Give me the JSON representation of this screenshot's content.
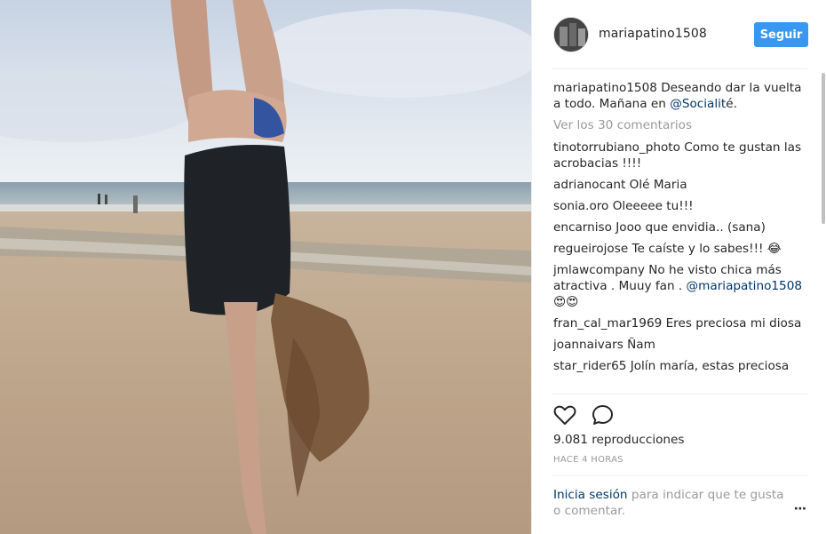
{
  "post": {
    "username": "mariapatino1508",
    "follow_label": "Seguir",
    "caption": {
      "username": "mariapatino1508",
      "text_before": " Deseando dar la vuelta a todo. Mañana en ",
      "mention": "@Socialit",
      "text_after": "é."
    },
    "view_more": "Ver los 30 comentarios",
    "comments": [
      {
        "user": "tinotorrubiano_photo",
        "text": " Como te gustan las acrobacias !!!!"
      },
      {
        "user": "adrianocant",
        "text": " Olé Maria"
      },
      {
        "user": "sonia.oro",
        "text": " Oleeeee tu!!!"
      },
      {
        "user": "encarniso",
        "text": " Jooo que envidia.. (sana)"
      },
      {
        "user": "regueirojose",
        "text": " Te caíste y lo sabes!!! 😂"
      },
      {
        "user": "jmlawcompany",
        "text": " No he visto chica más atractiva . Muuy fan . ",
        "mention": "@mariapatino1508",
        "after": " 😍😍"
      },
      {
        "user": "fran_cal_mar1969",
        "text": " Eres preciosa mi diosa"
      },
      {
        "user": "joannaivars",
        "text": " Ñam"
      },
      {
        "user": "star_rider65",
        "text": " Jolín maría, estas preciosa"
      }
    ],
    "views": "9.081 reproducciones",
    "time": "HACE 4 HORAS",
    "login": {
      "link": "Inicia sesión",
      "text": " para indicar que te gusta o comentar."
    },
    "more_icon": "⋯"
  },
  "icons": {
    "like": "heart-icon",
    "comment": "comment-icon",
    "options": "more-options-icon"
  }
}
